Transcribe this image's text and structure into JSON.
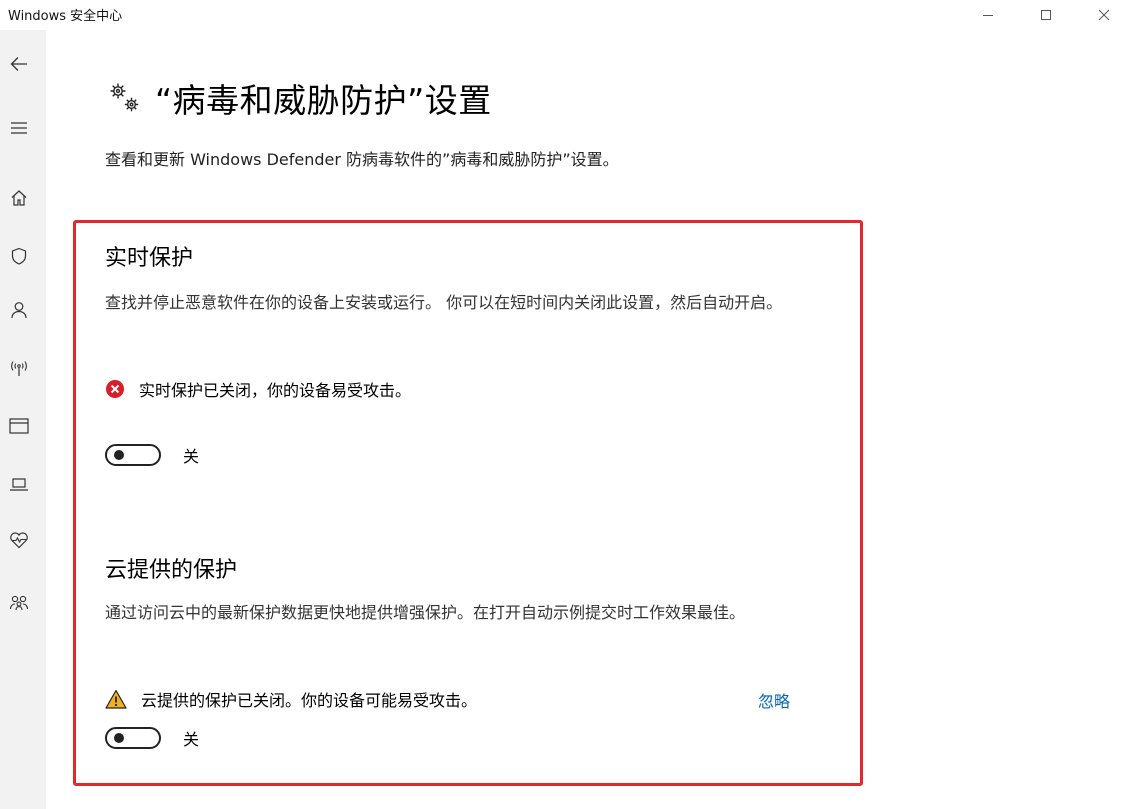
{
  "window": {
    "title": "Windows 安全中心"
  },
  "sidebar": {
    "items": [
      {
        "icon": "back-arrow-icon"
      },
      {
        "icon": "hamburger-menu-icon"
      },
      {
        "icon": "home-icon"
      },
      {
        "icon": "shield-icon"
      },
      {
        "icon": "person-icon"
      },
      {
        "icon": "wireless-signal-icon"
      },
      {
        "icon": "app-browser-window-icon"
      },
      {
        "icon": "laptop-icon"
      },
      {
        "icon": "heart-health-icon"
      },
      {
        "icon": "family-icon"
      }
    ]
  },
  "header": {
    "icon": "gears-icon",
    "title": "“病毒和威胁防护”设置",
    "description": "查看和更新 Windows Defender 防病毒软件的”病毒和威胁防护”设置。"
  },
  "realtime": {
    "title": "实时保护",
    "description": "查找并停止恶意软件在你的设备上安装或运行。 你可以在短时间内关闭此设置，然后自动开启。",
    "status_icon": "error-x-icon",
    "status_text": "实时保护已关闭，你的设备易受攻击。",
    "toggle_state": "off",
    "toggle_label": "关"
  },
  "cloud": {
    "title": "云提供的保护",
    "description": "通过访问云中的最新保护数据更快地提供增强保护。在打开自动示例提交时工作效果最佳。",
    "status_icon": "warning-triangle-icon",
    "status_text": "云提供的保护已关闭。你的设备可能易受攻击。",
    "dismiss_label": "忽略",
    "toggle_state": "off",
    "toggle_label": "关"
  },
  "colors": {
    "highlight_border": "#e3292e",
    "link": "#0067b8",
    "error": "#d71f2b",
    "warning": "#f2b01e",
    "sidebar_bg": "#f2f2f2"
  }
}
